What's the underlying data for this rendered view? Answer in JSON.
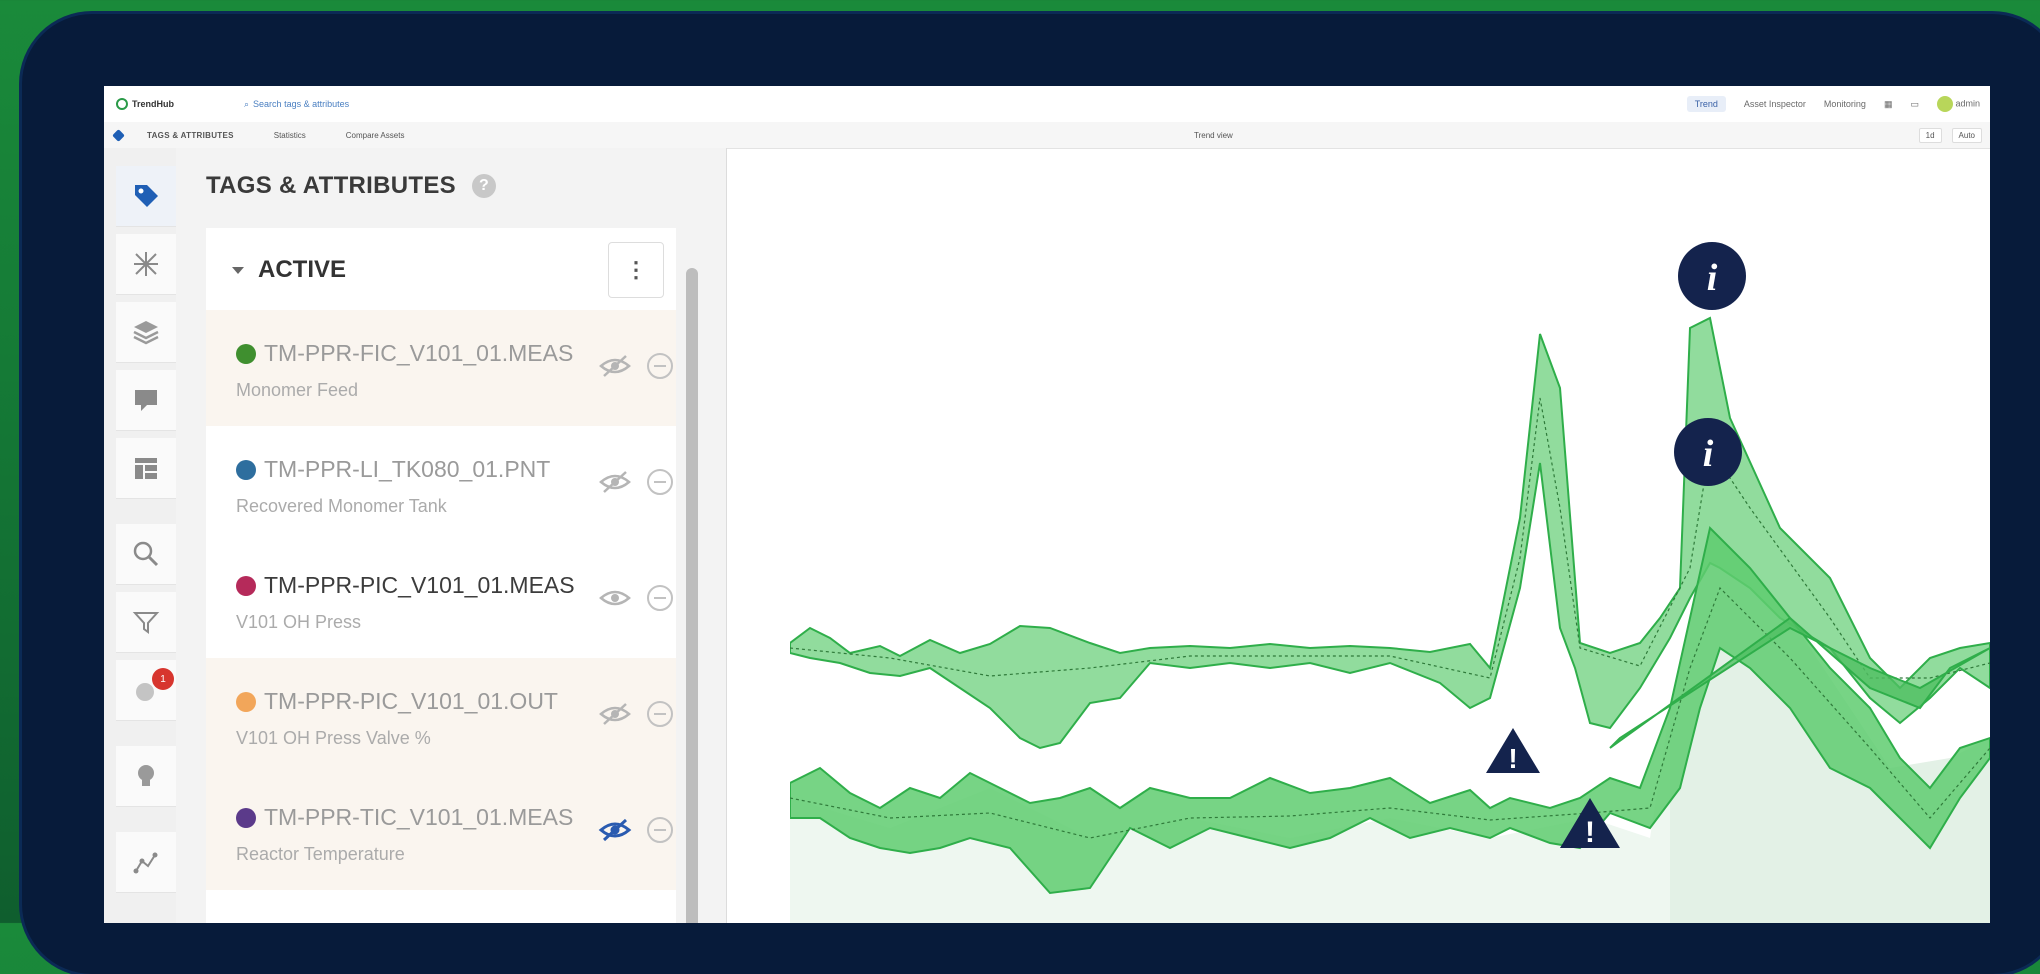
{
  "app": {
    "name": "TrendHub",
    "search_placeholder": "Search tags & attributes",
    "nav": [
      "Trend",
      "Asset Inspector",
      "Monitoring"
    ],
    "user": "admin"
  },
  "subbar": {
    "crumb": "TAGS & ATTRIBUTES",
    "btn_statistics": "Statistics",
    "btn_compare": "Compare Assets",
    "center_title": "Trend view",
    "right_a": "1d",
    "right_b": "Auto"
  },
  "panel": {
    "title": "TAGS & ATTRIBUTES",
    "help": "?",
    "section": "ACTIVE",
    "kebab": "⋮",
    "items": [
      {
        "name": "TM-PPR-FIC_V101_01.MEAS",
        "desc": "Monomer Feed",
        "color": "#3f8f2f",
        "visible": false
      },
      {
        "name": "TM-PPR-LI_TK080_01.PNT",
        "desc": "Recovered Monomer Tank",
        "color": "#2e6e9e",
        "visible": false
      },
      {
        "name": "TM-PPR-PIC_V101_01.MEAS",
        "desc": "V101 OH Press",
        "color": "#b52a5a",
        "visible": true
      },
      {
        "name": "TM-PPR-PIC_V101_01.OUT",
        "desc": "V101 OH Press Valve %",
        "color": "#f2a65a",
        "visible": false
      },
      {
        "name": "TM-PPR-TIC_V101_01.MEAS",
        "desc": "Reactor Temperature",
        "color": "#5b3a8a",
        "visible": false
      }
    ]
  },
  "rail": {
    "icons": [
      "tag-icon",
      "asset-tree-icon",
      "layers-icon",
      "comment-icon",
      "dashboard-icon",
      "search-icon",
      "filter-icon",
      "notification-icon",
      "lightbulb-icon",
      "trend-icon"
    ],
    "notification_count": "1"
  },
  "colors": {
    "accent_green": "#2fae4a",
    "band_fill": "#6fd07f",
    "marker_navy": "#14234d"
  }
}
